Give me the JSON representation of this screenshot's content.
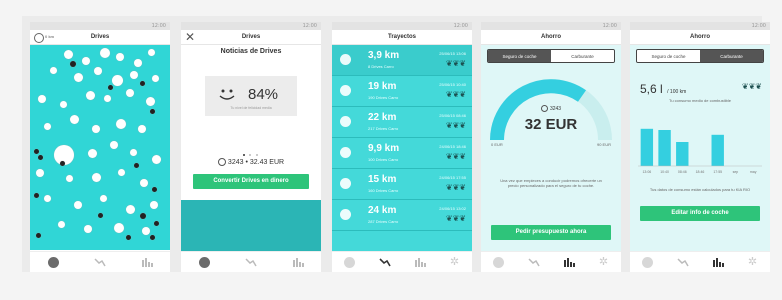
{
  "status": {
    "time": "12:00"
  },
  "s1": {
    "title": "Drives",
    "chip": "0 km"
  },
  "s2": {
    "title": "Drives",
    "heading": "Noticias de Drives",
    "percent": "84%",
    "caption": "Tu nivel de felicidad media",
    "balance": "3243 • 32.43 EUR",
    "button": "Convertir Drives en dinero"
  },
  "s3": {
    "title": "Trayectos",
    "trips": [
      {
        "km": "3,9 km",
        "sub": "8 Drives Carro",
        "date": "25/06/15 13:06"
      },
      {
        "km": "19 km",
        "sub": "190 Drives Carro",
        "date": "25/06/15 10:40"
      },
      {
        "km": "22 km",
        "sub": "217 Drives Carro",
        "date": "25/06/15 08:46"
      },
      {
        "km": "9,9 km",
        "sub": "100 Drives Carro",
        "date": "24/06/15 18:46"
      },
      {
        "km": "15 km",
        "sub": "160 Drives Carro",
        "date": "24/06/15 17:55"
      },
      {
        "km": "24 km",
        "sub": "287 Drives Carro",
        "date": "24/06/15 13:02"
      }
    ]
  },
  "s4": {
    "title": "Ahorro",
    "tab1": "Seguro de coche",
    "tab2": "Carburante",
    "drives": "3243",
    "amount": "32 EUR",
    "min": "0 EUR",
    "max": "90 EUR",
    "text": "Una vez que empieces a conducir podremos ofrecerte un precio personalizado para el seguro de tu coche.",
    "button": "Pedir presupuesto ahora"
  },
  "s5": {
    "title": "Ahorro",
    "tab1": "Seguro de coche",
    "tab2": "Carburante",
    "value": "5,6 l",
    "unit": "/ 100 km",
    "subtitle": "Tu consumo medio de combustible",
    "labels": [
      "13:06",
      "10:40",
      "08:46",
      "18:46",
      "17:55",
      "sep",
      "may"
    ],
    "text": "Tus datos de consumo están calculados para tu KIA RIO",
    "button": "Editar info de coche"
  },
  "chart_data": {
    "type": "bar",
    "categories": [
      "13:06",
      "10:40",
      "08:46",
      "18:46",
      "17:55",
      "sep",
      "may"
    ],
    "values": [
      6.2,
      6.0,
      4.0,
      0,
      5.2,
      0,
      0
    ],
    "title": "",
    "xlabel": "",
    "ylabel": "",
    "ylim": [
      0,
      8
    ]
  },
  "icons": [
    "face-icon",
    "route-icon",
    "chart-icon",
    "gear-icon"
  ]
}
